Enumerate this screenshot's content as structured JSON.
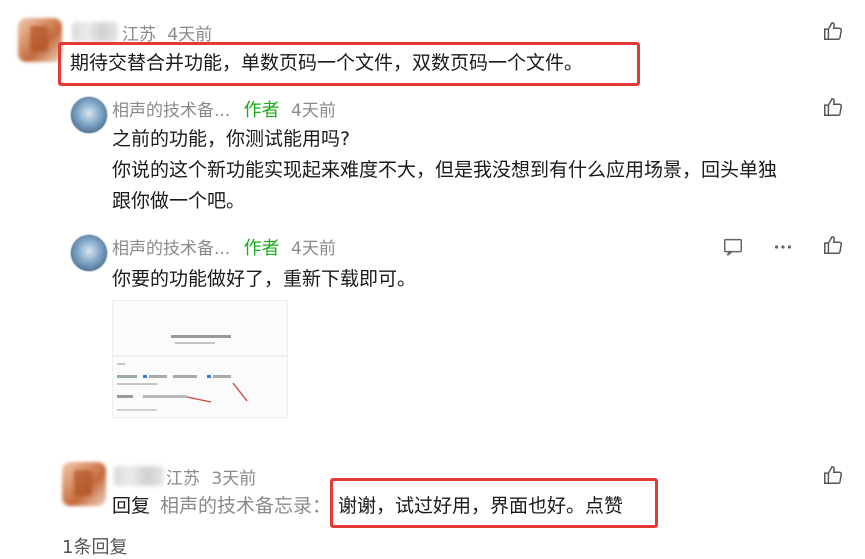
{
  "comments": [
    {
      "location": "江苏",
      "time": "4天前",
      "text": "期待交替合并功能，单数页码一个文件，双数页码一个文件。"
    },
    {
      "username": "相声的技术备...",
      "author_badge": "作者",
      "time": "4天前",
      "lines": [
        "之前的功能，你测试能用吗?",
        "你说的这个新功能实现起来难度不大，但是我没想到有什么应用场景，回头单独",
        "跟你做一个吧。"
      ]
    },
    {
      "username": "相声的技术备...",
      "author_badge": "作者",
      "time": "4天前",
      "text": "你要的功能做好了，重新下载即可。"
    },
    {
      "location": "江苏",
      "time": "3天前",
      "reply_prefix": "回复",
      "reply_target": "相声的技术备忘录：",
      "reply_text": "谢谢，试过好用，界面也好。点赞"
    }
  ],
  "footer_partial": "1条回复",
  "colors": {
    "author_green": "#1aad19",
    "highlight_red": "#e53935",
    "meta_gray": "#8a8a8a"
  },
  "icons": [
    "like-icon",
    "reply-icon",
    "more-icon"
  ]
}
